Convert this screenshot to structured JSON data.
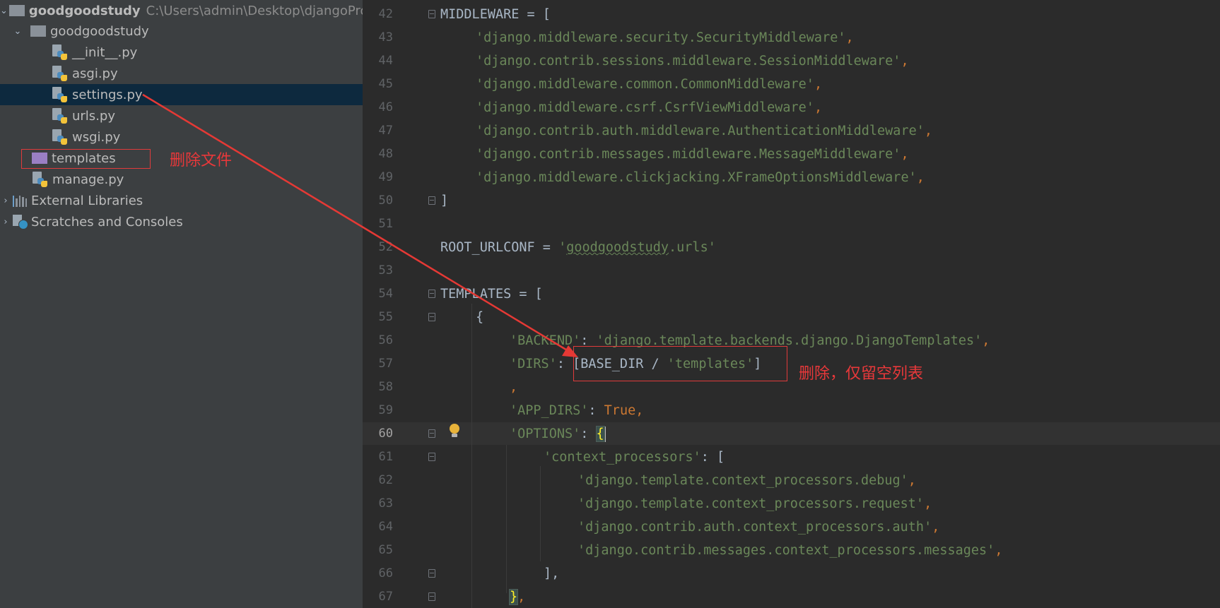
{
  "project_tree": {
    "root": {
      "name": "goodgoodstudy",
      "path": "C:\\Users\\admin\\Desktop\\djangoProj"
    },
    "package": {
      "name": "goodgoodstudy"
    },
    "files": [
      "__init__.py",
      "asgi.py",
      "settings.py",
      "urls.py",
      "wsgi.py"
    ],
    "templates_folder": "templates",
    "manage": "manage.py",
    "external_libraries": "External Libraries",
    "scratches": "Scratches and Consoles"
  },
  "annotations": {
    "delete_folder": "删除文件",
    "delete_keep_empty": "删除，仅留空列表"
  },
  "editor": {
    "line_numbers": [
      "42",
      "43",
      "44",
      "45",
      "46",
      "47",
      "48",
      "49",
      "50",
      "51",
      "52",
      "53",
      "54",
      "55",
      "56",
      "57",
      "58",
      "59",
      "60",
      "61",
      "62",
      "63",
      "64",
      "65",
      "66",
      "67"
    ],
    "current_line": "60",
    "lines": {
      "l42": "MIDDLEWARE = [",
      "l43": "'django.middleware.security.SecurityMiddleware'",
      "l44": "'django.contrib.sessions.middleware.SessionMiddleware'",
      "l45": "'django.middleware.common.CommonMiddleware'",
      "l46": "'django.middleware.csrf.CsrfViewMiddleware'",
      "l47": "'django.contrib.auth.middleware.AuthenticationMiddleware'",
      "l48": "'django.contrib.messages.middleware.MessageMiddleware'",
      "l49": "'django.middleware.clickjacking.XFrameOptionsMiddleware'",
      "l50": "]",
      "l52_name": "ROOT_URLCONF = ",
      "l52_val_open": "'",
      "l52_val_word": "goodgoodstudy",
      "l52_val_close": ".urls'",
      "l54": "TEMPLATES = [",
      "l55": "{",
      "l56_key": "'BACKEND'",
      "l56_val": "'django.template.backends.django.DjangoTemplates'",
      "l57_key": "'DIRS'",
      "l57_a": "[BASE_DIR / ",
      "l57_str": "'templates'",
      "l57_b": "]",
      "l58": ",",
      "l59_key": "'APP_DIRS'",
      "l59_val": "True",
      "l60_key": "'OPTIONS'",
      "l60_brace": "{",
      "l61_key": "'context_processors'",
      "l61_rest": ": [",
      "l62": "'django.template.context_processors.debug'",
      "l63": "'django.template.context_processors.request'",
      "l64": "'django.contrib.auth.context_processors.auth'",
      "l65": "'django.contrib.messages.context_processors.messages'",
      "l66": "],",
      "l67_brace": "}"
    },
    "punct": {
      "comma": ",",
      "colon": ": ",
      "bracket_close": "]"
    }
  },
  "colors": {
    "string": "#6a8759",
    "keyword": "#cc7832",
    "annotation_red": "#e8383a",
    "selection": "#0d293e"
  },
  "icons": [
    "folder-icon",
    "python-file-icon",
    "library-icon",
    "scratches-icon",
    "lightbulb-icon",
    "fold-icon"
  ]
}
